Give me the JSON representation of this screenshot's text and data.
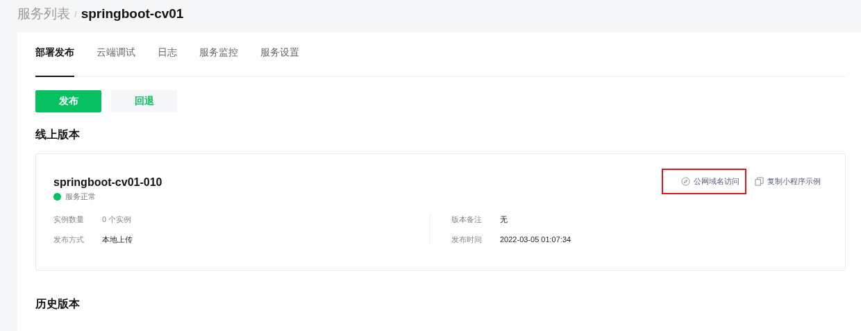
{
  "breadcrumb": {
    "parent": "服务列表",
    "separator": "/",
    "current": "springboot-cv01"
  },
  "tabs": [
    {
      "label": "部署发布",
      "selected": true
    },
    {
      "label": "云端调试",
      "selected": false
    },
    {
      "label": "日志",
      "selected": false
    },
    {
      "label": "服务监控",
      "selected": false
    },
    {
      "label": "服务设置",
      "selected": false
    }
  ],
  "buttons": [
    {
      "label": "发布",
      "kind": "primary"
    },
    {
      "label": "回退",
      "kind": "secondary"
    }
  ],
  "online_version": {
    "heading": "线上版本",
    "name": "springboot-cv01-010",
    "status": {
      "label": "服务正常",
      "color": "#07c160"
    },
    "actions": [
      {
        "label": "公网域名访问",
        "kind": "compass",
        "highlighted": true
      },
      {
        "label": "复制小程序示例",
        "kind": "copy",
        "highlighted": false
      }
    ],
    "fields_left": [
      {
        "label": "实例数量",
        "value": "0 个实例",
        "muted": true
      },
      {
        "label": "发布方式",
        "value": "本地上传",
        "muted": false
      }
    ],
    "fields_right": [
      {
        "label": "版本备注",
        "value": "无",
        "muted": false
      },
      {
        "label": "发布时间",
        "value": "2022-03-05 01:07:34",
        "muted": false
      }
    ]
  },
  "history": {
    "heading": "历史版本"
  }
}
